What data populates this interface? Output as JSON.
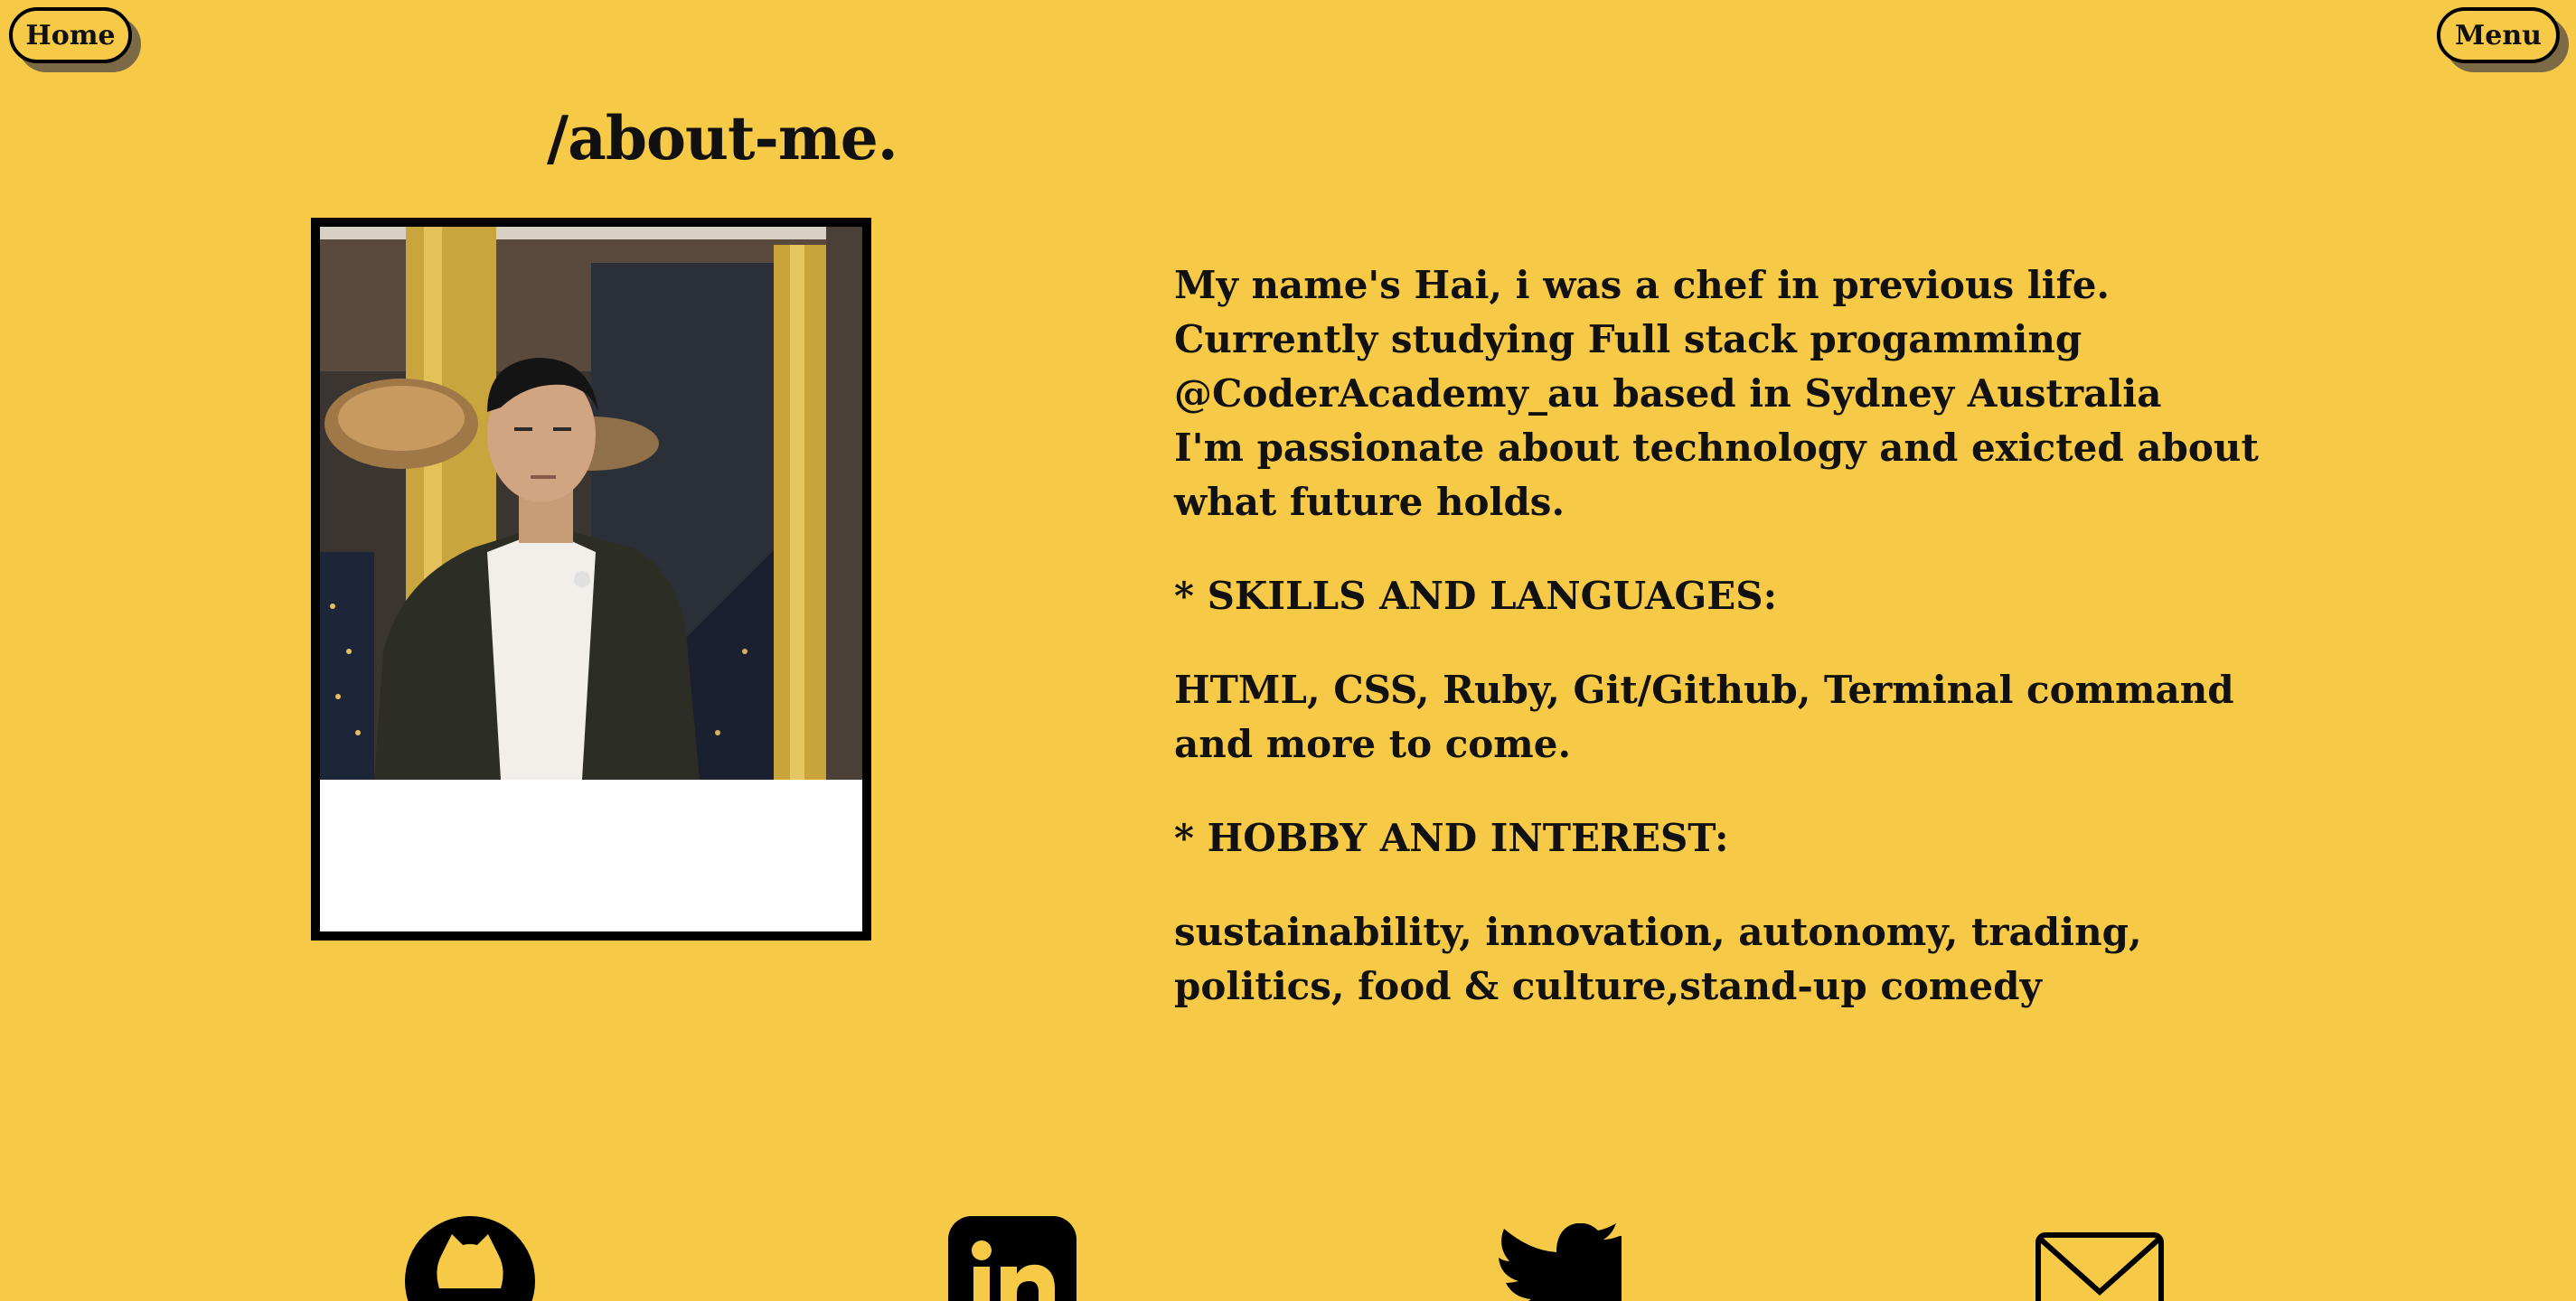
{
  "nav": {
    "home_label": "Home",
    "menu_label": "Menu"
  },
  "page": {
    "title": "/about-me."
  },
  "about": {
    "intro_line1": "My name's Hai, i was a chef in previous life. Currently studying Full stack progamming @CoderAcademy_au based in Sydney Australia",
    "intro_line2": "I'm passionate about technology and exicted about what future holds.",
    "skills_heading": "* SKILLS AND LANGUAGES:",
    "skills_text": "HTML, CSS, Ruby, Git/Github, Terminal command and more to come.",
    "hobby_heading": "* HOBBY AND INTEREST:",
    "hobby_text": "sustainability, innovation, autonomy, trading, politics, food & culture,stand-up comedy"
  },
  "social": {
    "icons": [
      "github-icon",
      "linkedin-icon",
      "twitter-icon",
      "mail-icon"
    ]
  },
  "colors": {
    "background": "#F6CA47",
    "text": "#111111",
    "button_shadow": "#7b6a45"
  }
}
